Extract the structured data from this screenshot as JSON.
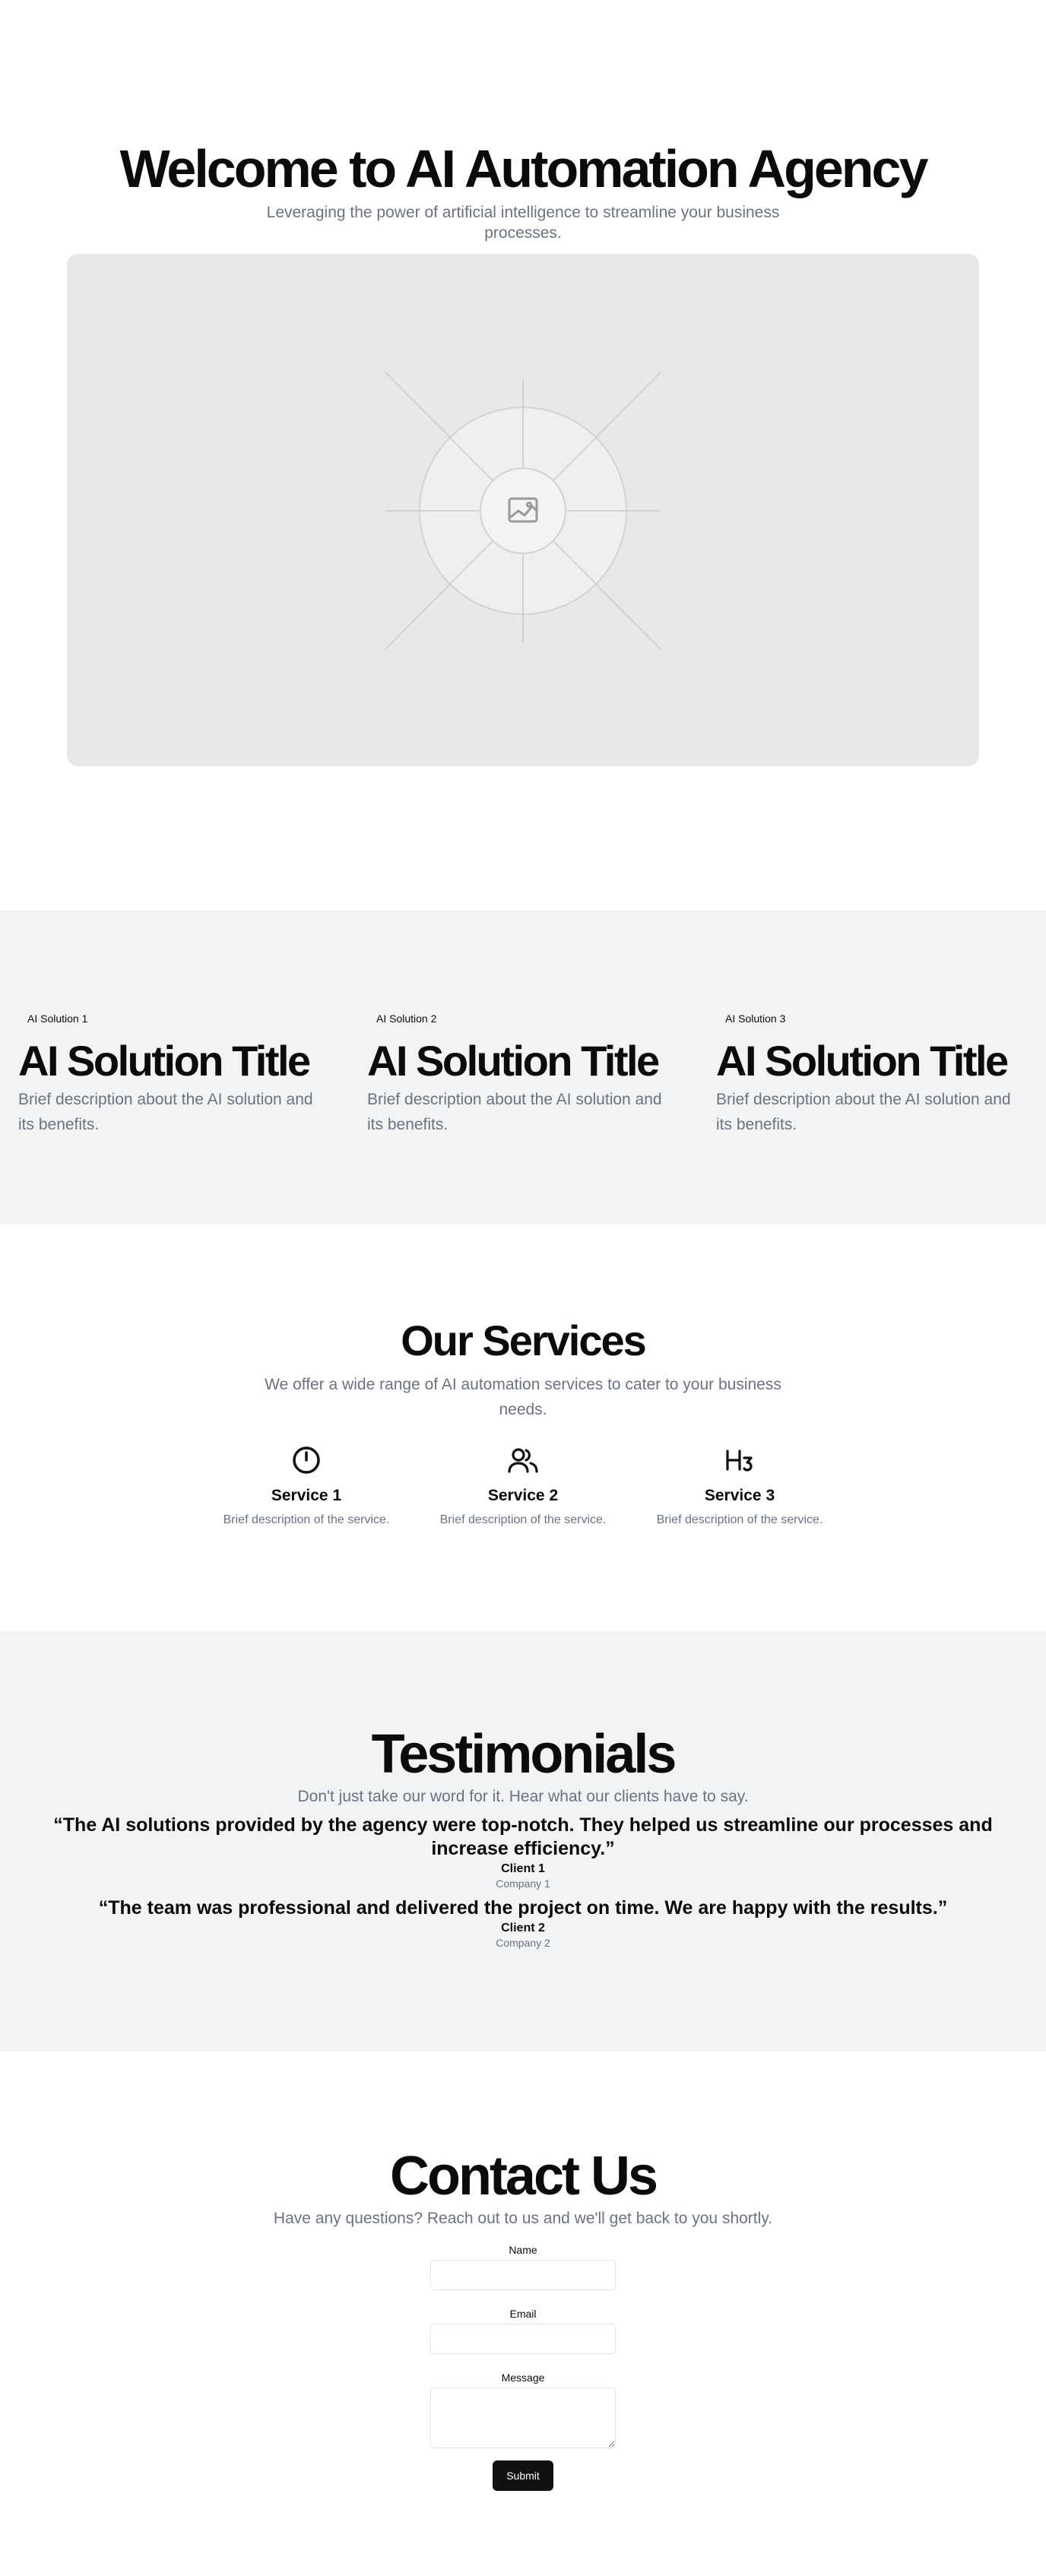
{
  "hero": {
    "title": "Welcome to AI Automation Agency",
    "subtitle": "Leveraging the power of artificial intelligence to streamline your business processes.",
    "image_icon": "image-placeholder-icon"
  },
  "solutions": [
    {
      "badge": "AI Solution 1",
      "title": "AI Solution Title",
      "description": "Brief description about the AI solution and its benefits."
    },
    {
      "badge": "AI Solution 2",
      "title": "AI Solution Title",
      "description": "Brief description about the AI solution and its benefits."
    },
    {
      "badge": "AI Solution 3",
      "title": "AI Solution Title",
      "description": "Brief description about the AI solution and its benefits."
    }
  ],
  "services": {
    "title": "Our Services",
    "subtitle": "We offer a wide range of AI automation services to cater to your business needs.",
    "items": [
      {
        "icon": "clock-icon",
        "name": "Service 1",
        "description": "Brief description of the service."
      },
      {
        "icon": "users-icon",
        "name": "Service 2",
        "description": "Brief description of the service."
      },
      {
        "icon": "heading-3-icon",
        "name": "Service 3",
        "description": "Brief description of the service."
      }
    ]
  },
  "testimonials": {
    "title": "Testimonials",
    "subtitle": "Don't just take our word for it. Hear what our clients have to say.",
    "items": [
      {
        "quote": "“The AI solutions provided by the agency were top-notch. They helped us streamline our processes and increase efficiency.”",
        "client": "Client 1",
        "company": "Company 1"
      },
      {
        "quote": "“The team was professional and delivered the project on time. We are happy with the results.”",
        "client": "Client 2",
        "company": "Company 2"
      }
    ]
  },
  "contact": {
    "title": "Contact Us",
    "subtitle": "Have any questions? Reach out to us and we'll get back to you shortly.",
    "name_label": "Name",
    "name_value": "",
    "email_label": "Email",
    "email_value": "",
    "message_label": "Message",
    "message_value": "",
    "submit_label": "Submit"
  },
  "colors": {
    "text": "#0b0b0b",
    "muted": "#6b7280",
    "section_bg": "#f2f3f5",
    "placeholder_bg": "#e8e8e8",
    "button_bg": "#111111"
  }
}
